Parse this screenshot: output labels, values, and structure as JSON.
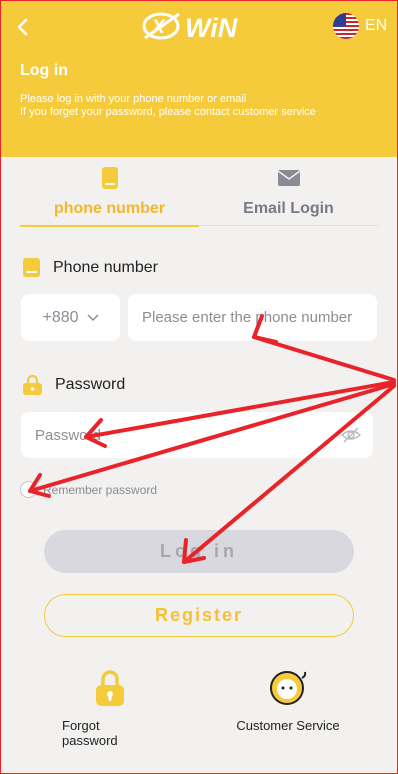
{
  "header": {
    "back_icon": "chevron-left-icon",
    "logo_text": "WiN",
    "language": "EN",
    "title": "Log in",
    "subtitle_line1": "Please log in with your phone number or email",
    "subtitle_line2": "If you forget your password, please contact customer service"
  },
  "tabs": [
    {
      "label": "phone number",
      "icon": "phone-icon",
      "active": true
    },
    {
      "label": "Email Login",
      "icon": "envelope-icon",
      "active": false
    }
  ],
  "form": {
    "phone_label": "Phone number",
    "country_code": "+880",
    "phone_placeholder": "Please enter the phone number",
    "password_label": "Password",
    "password_placeholder": "Password",
    "remember_label": "Remember password",
    "login_label": "Log in",
    "register_label": "Register"
  },
  "bottom": {
    "forgot_label": "Forgot password",
    "service_label": "Customer Service"
  },
  "colors": {
    "brand_yellow": "#f6cb3b",
    "background": "#f2f1f0",
    "annotation_red": "#e8232a"
  }
}
